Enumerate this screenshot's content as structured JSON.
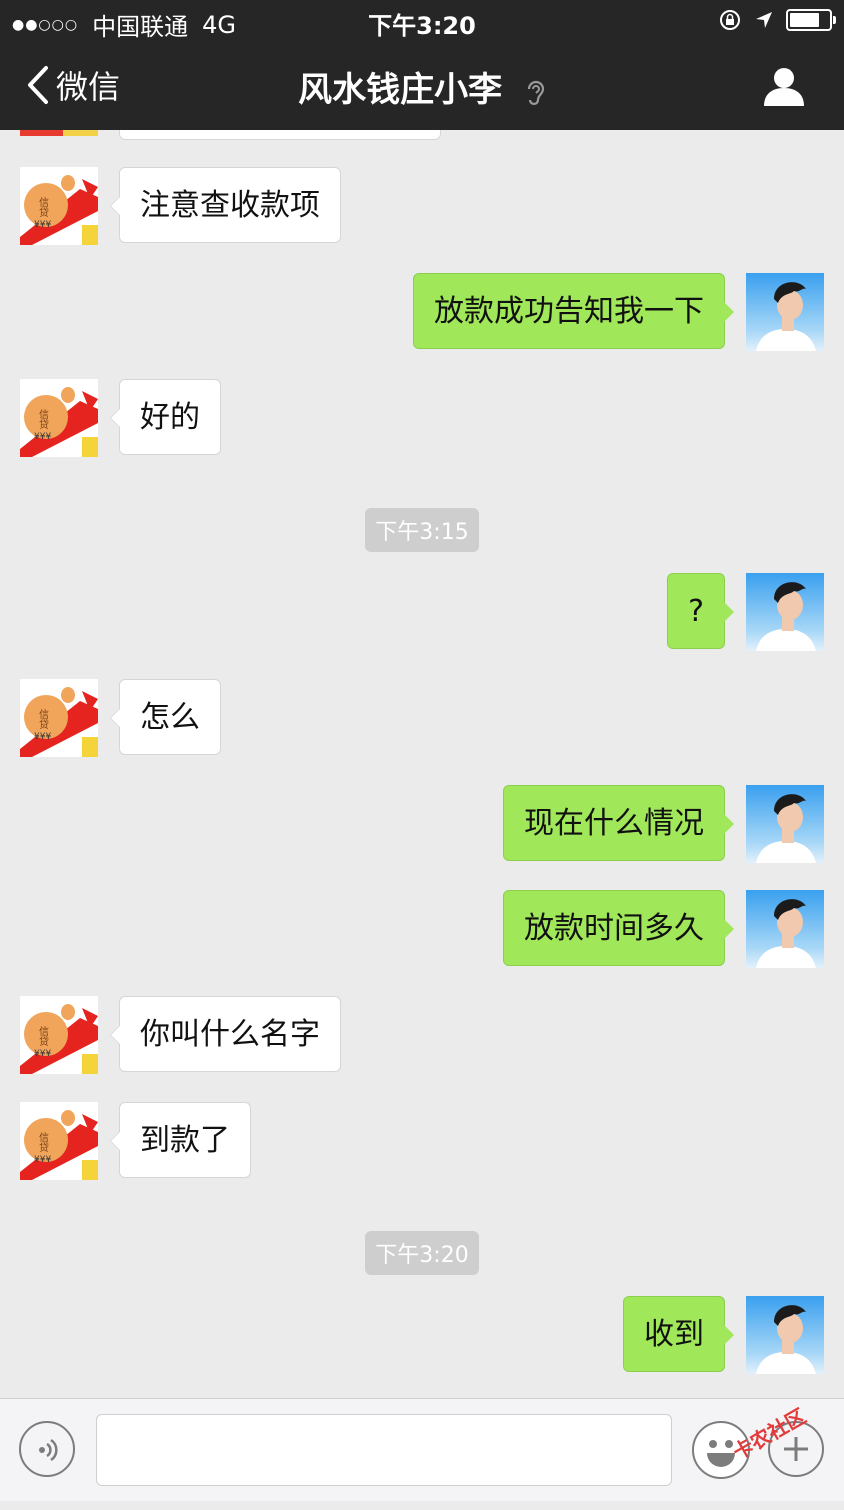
{
  "status_bar": {
    "signal": "●●○○○",
    "carrier": "中国联通",
    "network": "4G",
    "time": "下午3:20",
    "battery_level": 0.85
  },
  "nav": {
    "back_label": "微信",
    "title": "风水钱庄小李"
  },
  "contact_avatar": {
    "badge_text": "信贷"
  },
  "messages": [
    {
      "side": "in",
      "text": "注意查收款项"
    },
    {
      "side": "out",
      "text": "放款成功告知我一下"
    },
    {
      "side": "in",
      "text": "好的"
    },
    {
      "timestamp": "下午3:15"
    },
    {
      "side": "out",
      "text": "?"
    },
    {
      "side": "in",
      "text": "怎么"
    },
    {
      "side": "out",
      "text": "现在什么情况"
    },
    {
      "side": "out",
      "text": "放款时间多久"
    },
    {
      "side": "in",
      "text": "你叫什么名字"
    },
    {
      "side": "in",
      "text": "到款了"
    },
    {
      "timestamp": "下午3:20"
    },
    {
      "side": "out",
      "text": "收到"
    }
  ],
  "watermark": "卡农社区",
  "colors": {
    "header": "#262626",
    "outgoing_bubble": "#a0e75a",
    "chat_background": "#ebebeb"
  }
}
